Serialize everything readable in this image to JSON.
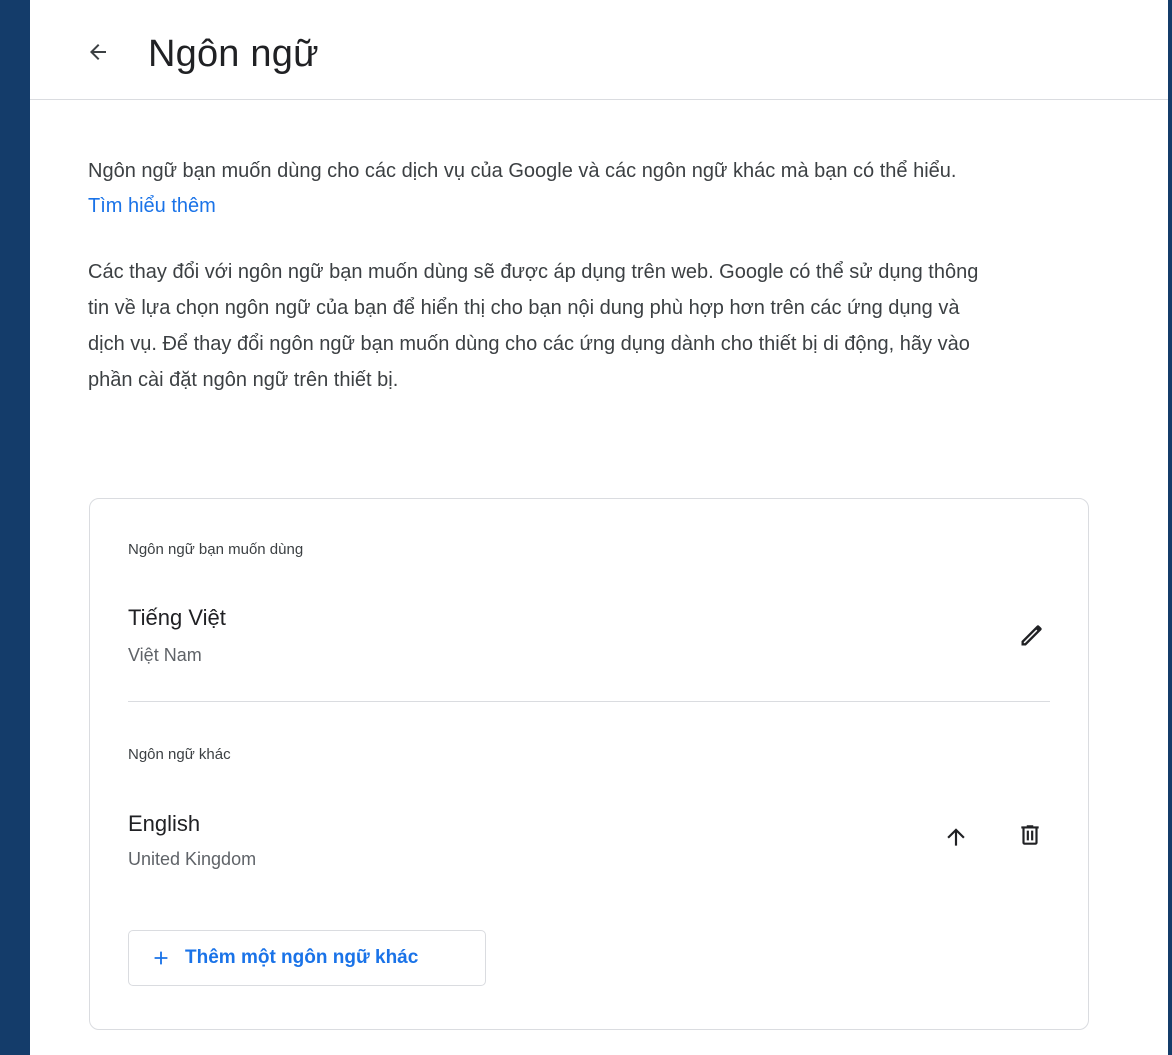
{
  "header": {
    "title": "Ngôn ngữ"
  },
  "intro": {
    "text": "Ngôn ngữ bạn muốn dùng cho các dịch vụ của Google và các ngôn ngữ khác mà bạn có thể hiểu.",
    "learn_more": "Tìm hiểu thêm"
  },
  "note": {
    "text": "Các thay đổi với ngôn ngữ bạn muốn dùng sẽ được áp dụng trên web. Google có thể sử dụng thông tin về lựa chọn ngôn ngữ của bạn để hiển thị cho bạn nội dung phù hợp hơn trên các ứng dụng và dịch vụ. Để thay đổi ngôn ngữ bạn muốn dùng cho các ứng dụng dành cho thiết bị di động, hãy vào phần cài đặt ngôn ngữ trên thiết bị."
  },
  "preferred": {
    "label": "Ngôn ngữ bạn muốn dùng",
    "language": "Tiếng Việt",
    "region": "Việt Nam"
  },
  "other": {
    "label": "Ngôn ngữ khác",
    "languages": [
      {
        "language": "English",
        "region": "United Kingdom"
      }
    ]
  },
  "add_button": {
    "label": "Thêm một ngôn ngữ khác"
  },
  "icons": {
    "back": "arrow-back-icon",
    "edit": "pencil-icon",
    "move_up": "arrow-up-icon",
    "delete": "trash-icon",
    "add": "plus-icon"
  },
  "colors": {
    "frame": "#143c6a",
    "link": "#1a73e8",
    "text": "#3c4043",
    "divider": "#dadce0"
  }
}
